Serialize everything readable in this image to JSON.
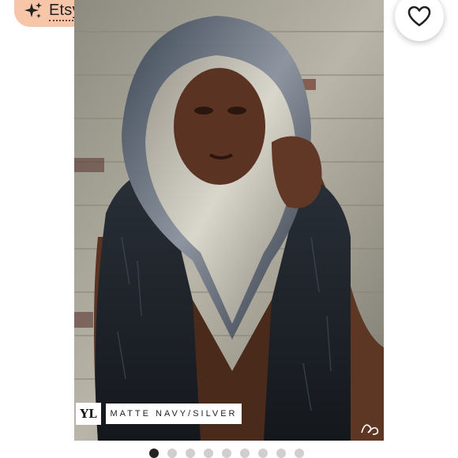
{
  "badge": {
    "label": "Etsy’s Pick",
    "icon": "sparkle-icon"
  },
  "actions": {
    "share_icon": "share-icon",
    "favorite_icon": "heart-icon"
  },
  "photo": {
    "caption": "MATTE NAVY/SILVER",
    "logo_text": "YL"
  },
  "carousel": {
    "total": 9,
    "active_index": 0
  },
  "colors": {
    "badge_bg": "#f7c6a8",
    "dot_active": "#222222",
    "dot_inactive": "#cfcfcf"
  }
}
